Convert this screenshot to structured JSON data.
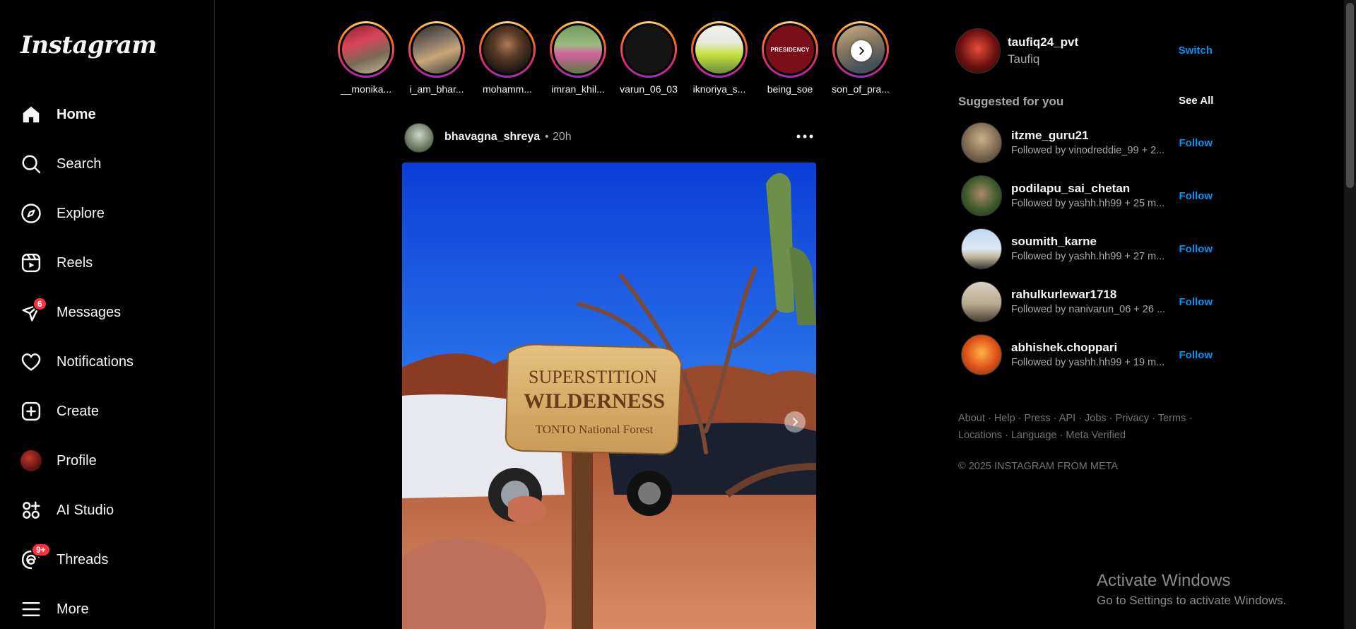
{
  "sidebar": {
    "logo": "Instagram",
    "items": [
      {
        "label": "Home"
      },
      {
        "label": "Search"
      },
      {
        "label": "Explore"
      },
      {
        "label": "Reels"
      },
      {
        "label": "Messages",
        "badge": "6"
      },
      {
        "label": "Notifications"
      },
      {
        "label": "Create"
      },
      {
        "label": "Profile"
      },
      {
        "label": "AI Studio"
      },
      {
        "label": "Threads",
        "badge": "9+"
      },
      {
        "label": "More"
      }
    ]
  },
  "stories": [
    {
      "name": "__monika..."
    },
    {
      "name": "i_am_bhar..."
    },
    {
      "name": "mohamm..."
    },
    {
      "name": "imran_khil..."
    },
    {
      "name": "varun_06_03"
    },
    {
      "name": "iknoriya_s..."
    },
    {
      "name": "being_soe",
      "logo_text": "PRESIDENCY"
    },
    {
      "name": "son_of_pra..."
    }
  ],
  "post": {
    "username": "bhavagna_shreya",
    "separator": "•",
    "time": "20h",
    "sign": {
      "line1": "SUPERSTITION",
      "line2": "WILDERNESS",
      "line3": "TONTO National Forest"
    }
  },
  "current_user": {
    "username": "taufiq24_pvt",
    "full_name": "Taufiq",
    "switch_label": "Switch"
  },
  "suggestions": {
    "title": "Suggested for you",
    "see_all": "See All",
    "follow_label": "Follow",
    "items": [
      {
        "username": "itzme_guru21",
        "sub": "Followed by vinodreddie_99 + 2..."
      },
      {
        "username": "podilapu_sai_chetan",
        "sub": "Followed by yashh.hh99 + 25 m..."
      },
      {
        "username": "soumith_karne",
        "sub": "Followed by yashh.hh99 + 27 m..."
      },
      {
        "username": "rahulkurlewar1718",
        "sub": "Followed by nanivarun_06 + 26 ..."
      },
      {
        "username": "abhishek.choppari",
        "sub": "Followed by yashh.hh99 + 19 m..."
      }
    ]
  },
  "footer": {
    "links": [
      "About",
      "Help",
      "Press",
      "API",
      "Jobs",
      "Privacy",
      "Terms",
      "Locations",
      "Language",
      "Meta Verified"
    ],
    "separator": "·",
    "copyright": "© 2025 INSTAGRAM FROM META"
  },
  "watermark": {
    "title": "Activate Windows",
    "subtitle": "Go to Settings to activate Windows."
  },
  "colors": {
    "accent": "#0095f6",
    "badge": "#ff3040",
    "background": "#000000",
    "muted": "#a8a8a8"
  }
}
